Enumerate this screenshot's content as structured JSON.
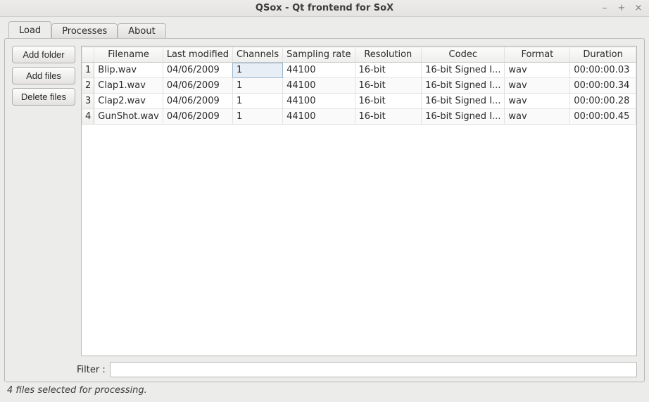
{
  "window": {
    "title": "QSox - Qt frontend for SoX"
  },
  "tabs": {
    "load": "Load",
    "processes": "Processes",
    "about": "About"
  },
  "buttons": {
    "add_folder": "Add folder",
    "add_files": "Add files",
    "delete_files": "Delete files"
  },
  "table": {
    "headers": {
      "filename": "Filename",
      "last_modified": "Last modified",
      "channels": "Channels",
      "sampling_rate": "Sampling rate",
      "resolution": "Resolution",
      "codec": "Codec",
      "format": "Format",
      "duration": "Duration"
    },
    "rows": [
      {
        "n": "1",
        "filename": "Blip.wav",
        "last_modified": "04/06/2009",
        "channels": "1",
        "sampling_rate": "44100",
        "resolution": "16-bit",
        "codec": "16-bit Signed I...",
        "format": "wav",
        "duration": "00:00:00.03"
      },
      {
        "n": "2",
        "filename": "Clap1.wav",
        "last_modified": "04/06/2009",
        "channels": "1",
        "sampling_rate": "44100",
        "resolution": "16-bit",
        "codec": "16-bit Signed I...",
        "format": "wav",
        "duration": "00:00:00.34"
      },
      {
        "n": "3",
        "filename": "Clap2.wav",
        "last_modified": "04/06/2009",
        "channels": "1",
        "sampling_rate": "44100",
        "resolution": "16-bit",
        "codec": "16-bit Signed I...",
        "format": "wav",
        "duration": "00:00:00.28"
      },
      {
        "n": "4",
        "filename": "GunShot.wav",
        "last_modified": "04/06/2009",
        "channels": "1",
        "sampling_rate": "44100",
        "resolution": "16-bit",
        "codec": "16-bit Signed I...",
        "format": "wav",
        "duration": "00:00:00.45"
      }
    ]
  },
  "filter": {
    "label": "Filter :",
    "value": ""
  },
  "status": "4 files selected for processing."
}
